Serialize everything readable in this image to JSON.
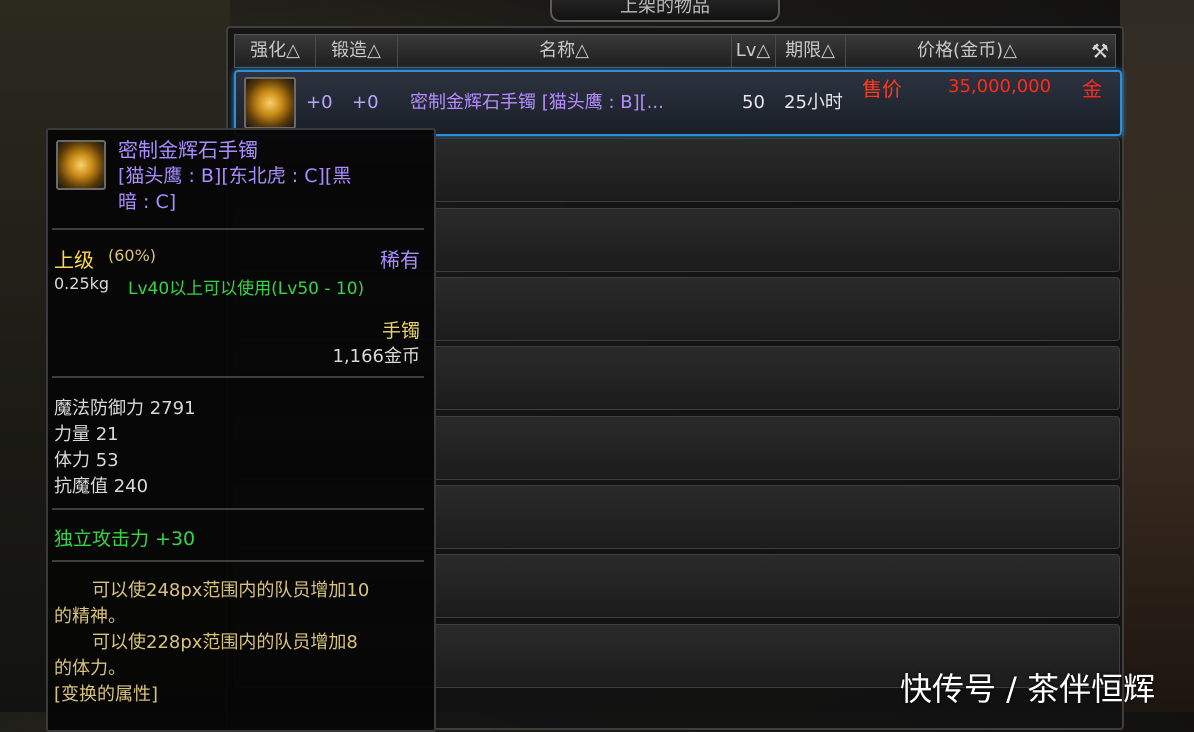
{
  "header": {
    "title": "上架的物品"
  },
  "columns": {
    "enhance": "强化△",
    "forge": "锻造△",
    "name": "名称△",
    "lv": "Lv△",
    "period": "期限△",
    "price": "价格(金币)△"
  },
  "listing": {
    "enhance": "+0",
    "forge": "+0",
    "name": "密制金辉石手镯 [猫头鹰 : B][...",
    "lv": "50",
    "period": "25小时",
    "sale_label": "售价",
    "price": "35,000,000",
    "currency": "金币"
  },
  "tooltip": {
    "title": "密制金辉石手镯",
    "subtitle_line1": "[猫头鹰 : B][东北虎 : C][黑",
    "subtitle_line2": "暗 : C]",
    "grade": "上级",
    "grade_pct": "(60%)",
    "rarity": "稀有",
    "weight": "0.25kg",
    "requirement": "Lv40以上可以使用(Lv50 - 10)",
    "type": "手镯",
    "sell_value": "1,166金币",
    "stats": [
      "魔法防御力 2791",
      "力量 21",
      "体力 53",
      "抗魔值 240"
    ],
    "independent_attack": "独立攻击力 +30",
    "effect1_line1": "可以使248px范围内的队员增加10",
    "effect1_line2": "的精神。",
    "effect2_line1": "可以使228px范围内的队员增加8",
    "effect2_line2": "的体力。",
    "transform_label": "[变换的属性]"
  },
  "watermark": "快传号 / 茶伴恒辉",
  "colors": {
    "selected_border": "#2f8fd6",
    "rare_purple": "#a98cff",
    "price_red": "#ff2a1a",
    "green": "#37d447",
    "grade_yellow": "#ffd94a"
  }
}
